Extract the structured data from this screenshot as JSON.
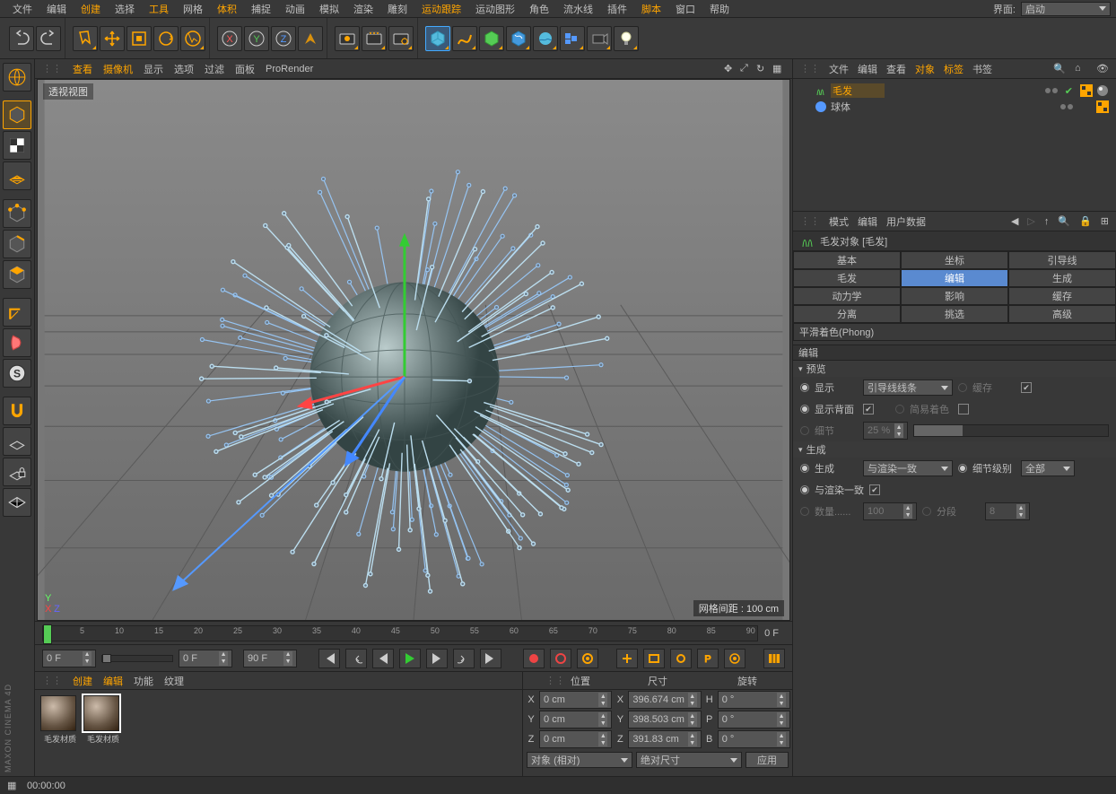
{
  "menu": [
    "文件",
    "编辑",
    "创建",
    "选择",
    "工具",
    "网格",
    "体积",
    "捕捉",
    "动画",
    "模拟",
    "渲染",
    "雕刻",
    "运动跟踪",
    "运动图形",
    "角色",
    "流水线",
    "插件",
    "脚本",
    "窗口",
    "帮助"
  ],
  "menu_hl": [
    2,
    4,
    6,
    12,
    17
  ],
  "layout_label": "界面:",
  "layout_value": "启动",
  "viewport": {
    "menus": [
      "查看",
      "摄像机",
      "显示",
      "选项",
      "过滤",
      "面板",
      "ProRender"
    ],
    "menus_hl": [
      0,
      1
    ],
    "label": "透视视图",
    "grid_info": "网格间距 : 100 cm"
  },
  "timeline": {
    "start": "0 F",
    "end": "90 F",
    "current": "0 F",
    "range_end": "0 F",
    "ticks": [
      "0",
      "5",
      "10",
      "15",
      "20",
      "25",
      "30",
      "35",
      "40",
      "45",
      "50",
      "55",
      "60",
      "65",
      "70",
      "75",
      "80",
      "85",
      "90"
    ]
  },
  "materials": {
    "menus": [
      "创建",
      "编辑",
      "功能",
      "纹理"
    ],
    "menus_hl": [
      0,
      1
    ],
    "items": [
      "毛发材质",
      "毛发材质"
    ]
  },
  "coord": {
    "hdr": [
      "位置",
      "尺寸",
      "旋转"
    ],
    "rows": [
      {
        "ax": "X",
        "p": "0 cm",
        "s": "396.674 cm",
        "rax": "H",
        "r": "0 °"
      },
      {
        "ax": "Y",
        "p": "0 cm",
        "s": "398.503 cm",
        "rax": "P",
        "r": "0 °"
      },
      {
        "ax": "Z",
        "p": "0 cm",
        "s": "391.83 cm",
        "rax": "B",
        "r": "0 °"
      }
    ],
    "dd1": "对象 (相对)",
    "dd2": "绝对尺寸",
    "apply": "应用"
  },
  "obj_panel": {
    "tabs": [
      "文件",
      "编辑",
      "查看",
      "对象",
      "标签",
      "书签"
    ],
    "tabs_hl": [
      3,
      4
    ],
    "tree": [
      {
        "name": "毛发",
        "sel": true,
        "icon": "hair"
      },
      {
        "name": "球体",
        "sel": false,
        "icon": "sphere"
      }
    ]
  },
  "attr": {
    "bar": [
      "模式",
      "编辑",
      "用户数据"
    ],
    "title": "毛发对象 [毛发]",
    "tabs": [
      "基本",
      "坐标",
      "引导线",
      "毛发",
      "编辑",
      "生成",
      "动力学",
      "影响",
      "缓存",
      "分离",
      "挑选",
      "高级"
    ],
    "tab_sel": 4,
    "phong": "平滑着色(Phong)",
    "section": "编辑",
    "preview": {
      "head": "预览",
      "show": "显示",
      "show_val": "引导线线条",
      "cache": "缓存",
      "backface": "显示背面",
      "flat": "简易着色",
      "detail": "细节",
      "detail_val": "25 %"
    },
    "gen": {
      "head": "生成",
      "gen": "生成",
      "gen_val": "与渲染一致",
      "lod": "细节级别",
      "lod_val": "全部",
      "match": "与渲染一致",
      "count": "数量......",
      "count_val": "100",
      "seg": "分段",
      "seg_val": "8"
    }
  },
  "status": "00:00:00",
  "logo": "MAXON CINEMA 4D"
}
